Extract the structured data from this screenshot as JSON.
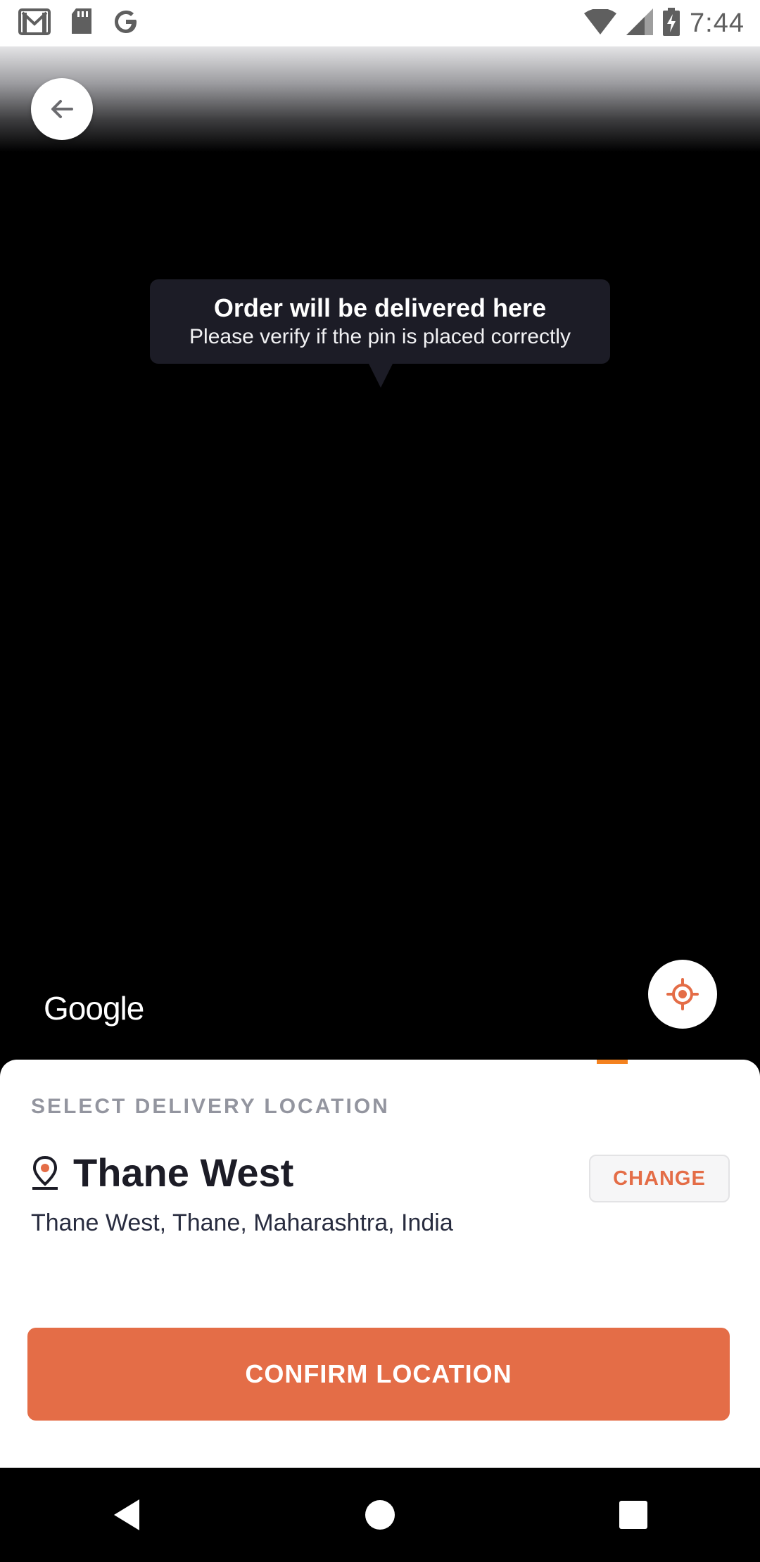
{
  "status_bar": {
    "time": "7:44",
    "icons_left": [
      "gmail-icon",
      "sd-card-icon",
      "google-icon"
    ],
    "icons_right": [
      "wifi-icon",
      "cellular-icon",
      "battery-charging-icon"
    ]
  },
  "map": {
    "tooltip": {
      "title": "Order will be delivered here",
      "subtitle": "Please verify if the pin is placed correctly"
    },
    "attribution": "Google"
  },
  "sheet": {
    "label": "SELECT DELIVERY LOCATION",
    "location_title": "Thane West",
    "location_address": "Thane West, Thane, Maharashtra, India",
    "change_label": "CHANGE",
    "confirm_label": "CONFIRM LOCATION"
  },
  "colors": {
    "accent": "#e46d47",
    "sheet_accent": "#f4821f",
    "tooltip_bg": "#1c1c26"
  }
}
